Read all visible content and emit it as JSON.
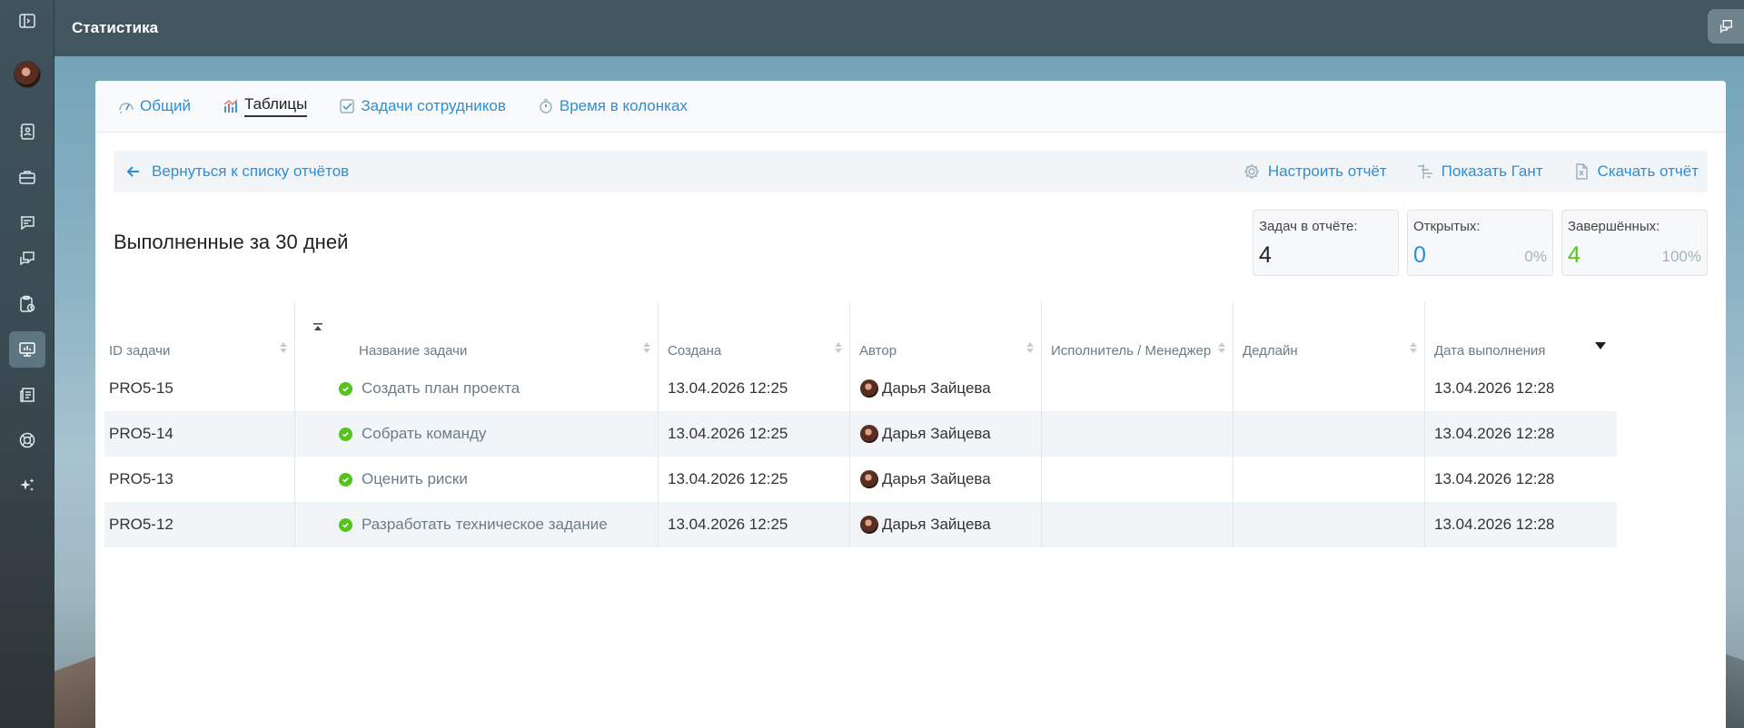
{
  "topbar": {
    "title": "Статистика"
  },
  "tabs": [
    {
      "label": "Общий",
      "icon": "speedometer-icon",
      "active": false
    },
    {
      "label": "Таблицы",
      "icon": "bar-chart-icon",
      "active": true
    },
    {
      "label": "Задачи сотрудников",
      "icon": "checkbox-icon",
      "active": false
    },
    {
      "label": "Время в колонках",
      "icon": "stopwatch-icon",
      "active": false
    }
  ],
  "toolbar": {
    "back_label": "Вернуться к списку отчётов",
    "configure_label": "Настроить отчёт",
    "gantt_label": "Показать Гант",
    "download_label": "Скачать отчёт"
  },
  "report": {
    "title": "Выполненные за 30 дней",
    "stats": {
      "total": {
        "label": "Задач в отчёте:",
        "value": "4"
      },
      "open": {
        "label": "Открытых:",
        "value": "0",
        "pct": "0%"
      },
      "done": {
        "label": "Завершённых:",
        "value": "4",
        "pct": "100%"
      }
    }
  },
  "table": {
    "columns": [
      "ID задачи",
      "Название задачи",
      "Создана",
      "Автор",
      "Исполнитель / Менеджер",
      "Дедлайн",
      "Дата выполнения"
    ],
    "rows": [
      {
        "id": "PRO5-15",
        "name": "Создать план проекта",
        "created": "13.04.2026 12:25",
        "author": "Дарья Зайцева",
        "assignee": "",
        "deadline": "",
        "done": "13.04.2026 12:28"
      },
      {
        "id": "PRO5-14",
        "name": "Собрать команду",
        "created": "13.04.2026 12:25",
        "author": "Дарья Зайцева",
        "assignee": "",
        "deadline": "",
        "done": "13.04.2026 12:28"
      },
      {
        "id": "PRO5-13",
        "name": "Оценить риски",
        "created": "13.04.2026 12:25",
        "author": "Дарья Зайцева",
        "assignee": "",
        "deadline": "",
        "done": "13.04.2026 12:28"
      },
      {
        "id": "PRO5-12",
        "name": "Разработать техническое задание",
        "created": "13.04.2026 12:25",
        "author": "Дарья Зайцева",
        "assignee": "",
        "deadline": "",
        "done": "13.04.2026 12:28"
      }
    ]
  },
  "colors": {
    "accent": "#2e8ed4",
    "success": "#52c41a",
    "sidebar": "#425660"
  }
}
